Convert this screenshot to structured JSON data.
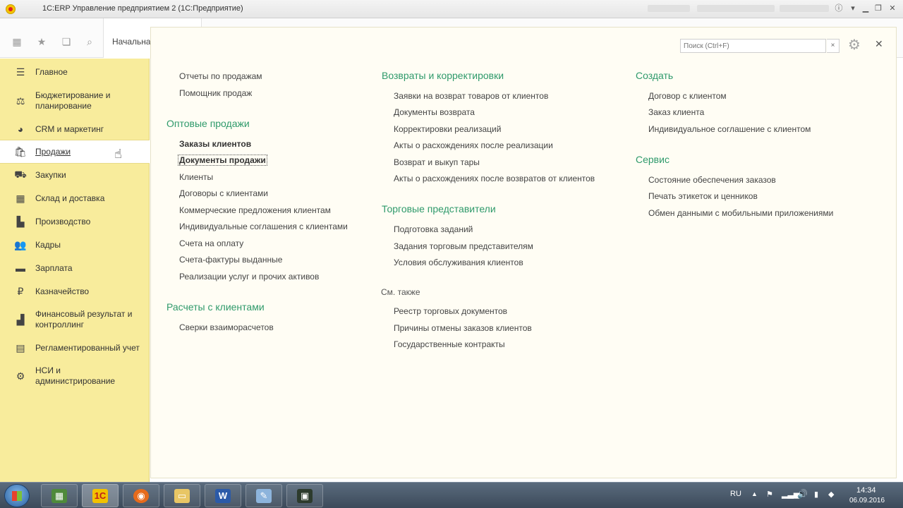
{
  "window": {
    "title": "1С:ERP Управление предприятием 2 (1С:Предприятие)"
  },
  "topnav": {
    "home_tab": "Начальна"
  },
  "sidebar": {
    "items": [
      {
        "label": "Главное",
        "icon": "menu-icon"
      },
      {
        "label": "Бюджетирование и\nпланирование",
        "icon": "budget-icon"
      },
      {
        "label": "CRM и маркетинг",
        "icon": "pie-chart-icon"
      },
      {
        "label": "Продажи",
        "icon": "shopping-bag-icon",
        "active": true
      },
      {
        "label": "Закупки",
        "icon": "cart-icon"
      },
      {
        "label": "Склад и доставка",
        "icon": "warehouse-icon"
      },
      {
        "label": "Производство",
        "icon": "factory-icon"
      },
      {
        "label": "Кадры",
        "icon": "people-icon"
      },
      {
        "label": "Зарплата",
        "icon": "money-icon"
      },
      {
        "label": "Казначейство",
        "icon": "coin-icon"
      },
      {
        "label": "Финансовый результат и\nконтроллинг",
        "icon": "bar-chart-icon"
      },
      {
        "label": "Регламентированный учет",
        "icon": "document-icon"
      },
      {
        "label": "НСИ и\nадминистрирование",
        "icon": "gear-icon"
      }
    ]
  },
  "main": {
    "search_placeholder": "Поиск (Ctrl+F)",
    "col1": {
      "top_links": [
        "Отчеты по продажам",
        "Помощник продаж"
      ],
      "wholesale_title": "Оптовые продажи",
      "wholesale_links": [
        "Заказы клиентов",
        "Документы продажи",
        "Клиенты",
        "Договоры с клиентами",
        "Коммерческие предложения клиентам",
        "Индивидуальные соглашения с клиентами",
        "Счета на оплату",
        "Счета-фактуры выданные",
        "Реализации услуг и прочих активов"
      ],
      "settlements_title": "Расчеты с клиентами",
      "settlements_links": [
        "Сверки взаиморасчетов"
      ]
    },
    "col2": {
      "returns_title": "Возвраты и корректировки",
      "returns_links": [
        "Заявки на возврат товаров от клиентов",
        "Документы возврата",
        "Корректировки реализаций",
        "Акты о расхождениях после реализации",
        "Возврат и выкуп тары",
        "Акты о расхождениях после возвратов от клиентов"
      ],
      "reps_title": "Торговые представители",
      "reps_links": [
        "Подготовка заданий",
        "Задания торговым представителям",
        "Условия обслуживания клиентов"
      ],
      "see_also_label": "См. также",
      "see_also_links": [
        "Реестр торговых документов",
        "Причины отмены заказов клиентов",
        "Государственные контракты"
      ]
    },
    "col3": {
      "create_title": "Создать",
      "create_links": [
        "Договор с клиентом",
        "Заказ клиента",
        "Индивидуальное соглашение с клиентом"
      ],
      "service_title": "Сервис",
      "service_links": [
        "Состояние обеспечения заказов",
        "Печать этикеток и ценников",
        "Обмен данными с мобильными приложениями"
      ]
    }
  },
  "taskbar": {
    "lang": "RU",
    "time": "14:34",
    "date": "06.09.2016",
    "apps": [
      "file-manager-icon",
      "1c-icon",
      "firefox-icon",
      "folder-icon",
      "word-icon",
      "paint-icon",
      "terminal-icon"
    ]
  },
  "colors": {
    "sidebar_bg": "#f8ec9c",
    "group_title": "#2f9a6b"
  }
}
